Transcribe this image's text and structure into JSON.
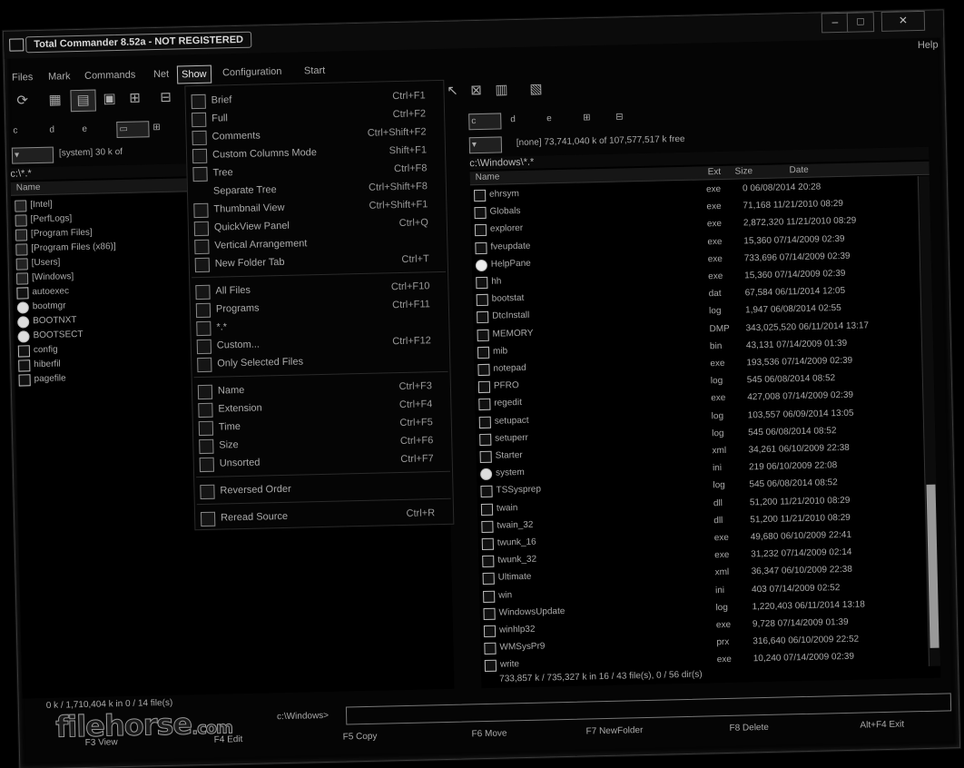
{
  "title": "Total Commander 8.52a - NOT REGISTERED",
  "window_controls": {
    "minimize": "–",
    "maximize": "□",
    "close": "✕"
  },
  "help": "Help",
  "menu": [
    "Files",
    "Mark",
    "Commands",
    "Net",
    "Show",
    "Configuration",
    "Start"
  ],
  "view_menu": [
    {
      "icon": "brief-icon",
      "label": "Brief",
      "shortcut": "Ctrl+F1"
    },
    {
      "icon": "full-icon",
      "label": "Full",
      "shortcut": "Ctrl+F2"
    },
    {
      "icon": "comments-icon",
      "label": "Comments",
      "shortcut": "Ctrl+Shift+F2"
    },
    {
      "icon": "custom-columns-icon",
      "label": "Custom Columns Mode",
      "shortcut": "Shift+F1"
    },
    {
      "icon": "tree-icon",
      "label": "Tree",
      "shortcut": "Ctrl+F8"
    },
    {
      "icon": "",
      "label": "Separate Tree",
      "shortcut": "Ctrl+Shift+F8"
    },
    {
      "icon": "thumbnail-icon",
      "label": "Thumbnail View",
      "shortcut": "Ctrl+Shift+F1"
    },
    {
      "icon": "quickview-icon",
      "label": "QuickView Panel",
      "shortcut": "Ctrl+Q"
    },
    {
      "icon": "vertical-icon",
      "label": "Vertical Arrangement",
      "shortcut": ""
    },
    {
      "icon": "new-tab-icon",
      "label": "New Folder Tab",
      "shortcut": "Ctrl+T"
    },
    {
      "icon": "all-files-icon",
      "label": "All Files",
      "shortcut": "Ctrl+F10"
    },
    {
      "icon": "programs-icon",
      "label": "Programs",
      "shortcut": "Ctrl+F11"
    },
    {
      "icon": "star-icon",
      "label": "*.*",
      "shortcut": ""
    },
    {
      "icon": "custom-icon",
      "label": "Custom...",
      "shortcut": "Ctrl+F12"
    },
    {
      "icon": "selected-icon",
      "label": "Only Selected Files",
      "shortcut": ""
    },
    {
      "icon": "name-icon",
      "label": "Name",
      "shortcut": "Ctrl+F3"
    },
    {
      "icon": "extension-icon",
      "label": "Extension",
      "shortcut": "Ctrl+F4"
    },
    {
      "icon": "time-icon",
      "label": "Time",
      "shortcut": "Ctrl+F5"
    },
    {
      "icon": "size-icon",
      "label": "Size",
      "shortcut": "Ctrl+F6"
    },
    {
      "icon": "unsorted-icon",
      "label": "Unsorted",
      "shortcut": "Ctrl+F7"
    },
    {
      "icon": "reverse-icon",
      "label": "Reversed Order",
      "shortcut": ""
    },
    {
      "icon": "reread-icon",
      "label": "Reread Source",
      "shortcut": "Ctrl+R"
    }
  ],
  "left_panel": {
    "drives": [
      "c",
      "d",
      "e"
    ],
    "free_space": "[system] 30 k of",
    "path": "c:\\*.*",
    "col_name": "Name",
    "items": [
      {
        "icon": "folder",
        "name": "[Intel]"
      },
      {
        "icon": "folder",
        "name": "[PerfLogs]"
      },
      {
        "icon": "folder",
        "name": "[Program Files]"
      },
      {
        "icon": "folder",
        "name": "[Program Files (x86)]"
      },
      {
        "icon": "folder",
        "name": "[Users]"
      },
      {
        "icon": "folder",
        "name": "[Windows]"
      },
      {
        "icon": "file",
        "name": "autoexec"
      },
      {
        "icon": "gear",
        "name": "bootmgr"
      },
      {
        "icon": "gear",
        "name": "BOOTNXT"
      },
      {
        "icon": "gear",
        "name": "BOOTSECT"
      },
      {
        "icon": "file",
        "name": "config"
      },
      {
        "icon": "file",
        "name": "hiberfil"
      },
      {
        "icon": "file",
        "name": "pagefile"
      }
    ],
    "status": "0 k / 1,710,404 k in 0 / 14 file(s)"
  },
  "right_panel": {
    "drives": [
      "c",
      "d",
      "e"
    ],
    "free_space": "[none] 73,741,040 k of 107,577,517 k free",
    "path": "c:\\Windows\\*.*",
    "col_name": "Name",
    "col_ext": "Ext",
    "col_size": "Size",
    "col_date": "Date",
    "items": [
      {
        "icon": "file",
        "name": "ehrsym",
        "ext": "exe",
        "meta": "0 06/08/2014 20:28"
      },
      {
        "icon": "file",
        "name": "Globals",
        "ext": "exe",
        "meta": "71,168 11/21/2010 08:29"
      },
      {
        "icon": "file",
        "name": "explorer",
        "ext": "exe",
        "meta": "2,872,320 11/21/2010 08:29"
      },
      {
        "icon": "file",
        "name": "fveupdate",
        "ext": "exe",
        "meta": "15,360 07/14/2009 02:39"
      },
      {
        "icon": "q",
        "name": "HelpPane",
        "ext": "exe",
        "meta": "733,696 07/14/2009 02:39"
      },
      {
        "icon": "file",
        "name": "hh",
        "ext": "exe",
        "meta": "15,360 07/14/2009 02:39"
      },
      {
        "icon": "file",
        "name": "bootstat",
        "ext": "dat",
        "meta": "67,584 06/11/2014 12:05"
      },
      {
        "icon": "file",
        "name": "DtcInstall",
        "ext": "log",
        "meta": "1,947 06/08/2014 02:55"
      },
      {
        "icon": "file",
        "name": "MEMORY",
        "ext": "DMP",
        "meta": "343,025,520 06/11/2014 13:17"
      },
      {
        "icon": "file",
        "name": "mib",
        "ext": "bin",
        "meta": "43,131 07/14/2009 01:39"
      },
      {
        "icon": "file",
        "name": "notepad",
        "ext": "exe",
        "meta": "193,536 07/14/2009 02:39"
      },
      {
        "icon": "file",
        "name": "PFRO",
        "ext": "log",
        "meta": "545 06/08/2014 08:52"
      },
      {
        "icon": "file",
        "name": "regedit",
        "ext": "exe",
        "meta": "427,008 07/14/2009 02:39"
      },
      {
        "icon": "file",
        "name": "setupact",
        "ext": "log",
        "meta": "103,557 06/09/2014 13:05"
      },
      {
        "icon": "file",
        "name": "setuperr",
        "ext": "log",
        "meta": "545 06/08/2014 08:52"
      },
      {
        "icon": "file",
        "name": "Starter",
        "ext": "xml",
        "meta": "34,261 06/10/2009 22:38"
      },
      {
        "icon": "gear",
        "name": "system",
        "ext": "ini",
        "meta": "219 06/10/2009 22:08"
      },
      {
        "icon": "file",
        "name": "TSSysprep",
        "ext": "log",
        "meta": "545 06/08/2014 08:52"
      },
      {
        "icon": "file",
        "name": "twain",
        "ext": "dll",
        "meta": "51,200 11/21/2010 08:29"
      },
      {
        "icon": "file",
        "name": "twain_32",
        "ext": "dll",
        "meta": "51,200 11/21/2010 08:29"
      },
      {
        "icon": "file",
        "name": "twunk_16",
        "ext": "exe",
        "meta": "49,680 06/10/2009 22:41"
      },
      {
        "icon": "file",
        "name": "twunk_32",
        "ext": "exe",
        "meta": "31,232 07/14/2009 02:14"
      },
      {
        "icon": "file",
        "name": "Ultimate",
        "ext": "xml",
        "meta": "36,347 06/10/2009 22:38"
      },
      {
        "icon": "file",
        "name": "win",
        "ext": "ini",
        "meta": "403 07/14/2009 02:52"
      },
      {
        "icon": "file",
        "name": "WindowsUpdate",
        "ext": "log",
        "meta": "1,220,403 06/11/2014 13:18"
      },
      {
        "icon": "file",
        "name": "winhlp32",
        "ext": "exe",
        "meta": "9,728 07/14/2009 01:39"
      },
      {
        "icon": "file",
        "name": "WMSysPr9",
        "ext": "prx",
        "meta": "316,640 06/10/2009 22:52"
      },
      {
        "icon": "file",
        "name": "write",
        "ext": "exe",
        "meta": "10,240 07/14/2009 02:39"
      }
    ],
    "status": "733,857 k / 735,327 k in 16 / 43 file(s), 0 / 56 dir(s)"
  },
  "command_path": "c:\\Windows>",
  "fkeys": [
    "F3 View",
    "F4 Edit",
    "F5 Copy",
    "F6 Move",
    "F7 NewFolder",
    "F8 Delete",
    "Alt+F4 Exit"
  ],
  "watermark": {
    "main": "filehorse",
    "suffix": ".com"
  }
}
